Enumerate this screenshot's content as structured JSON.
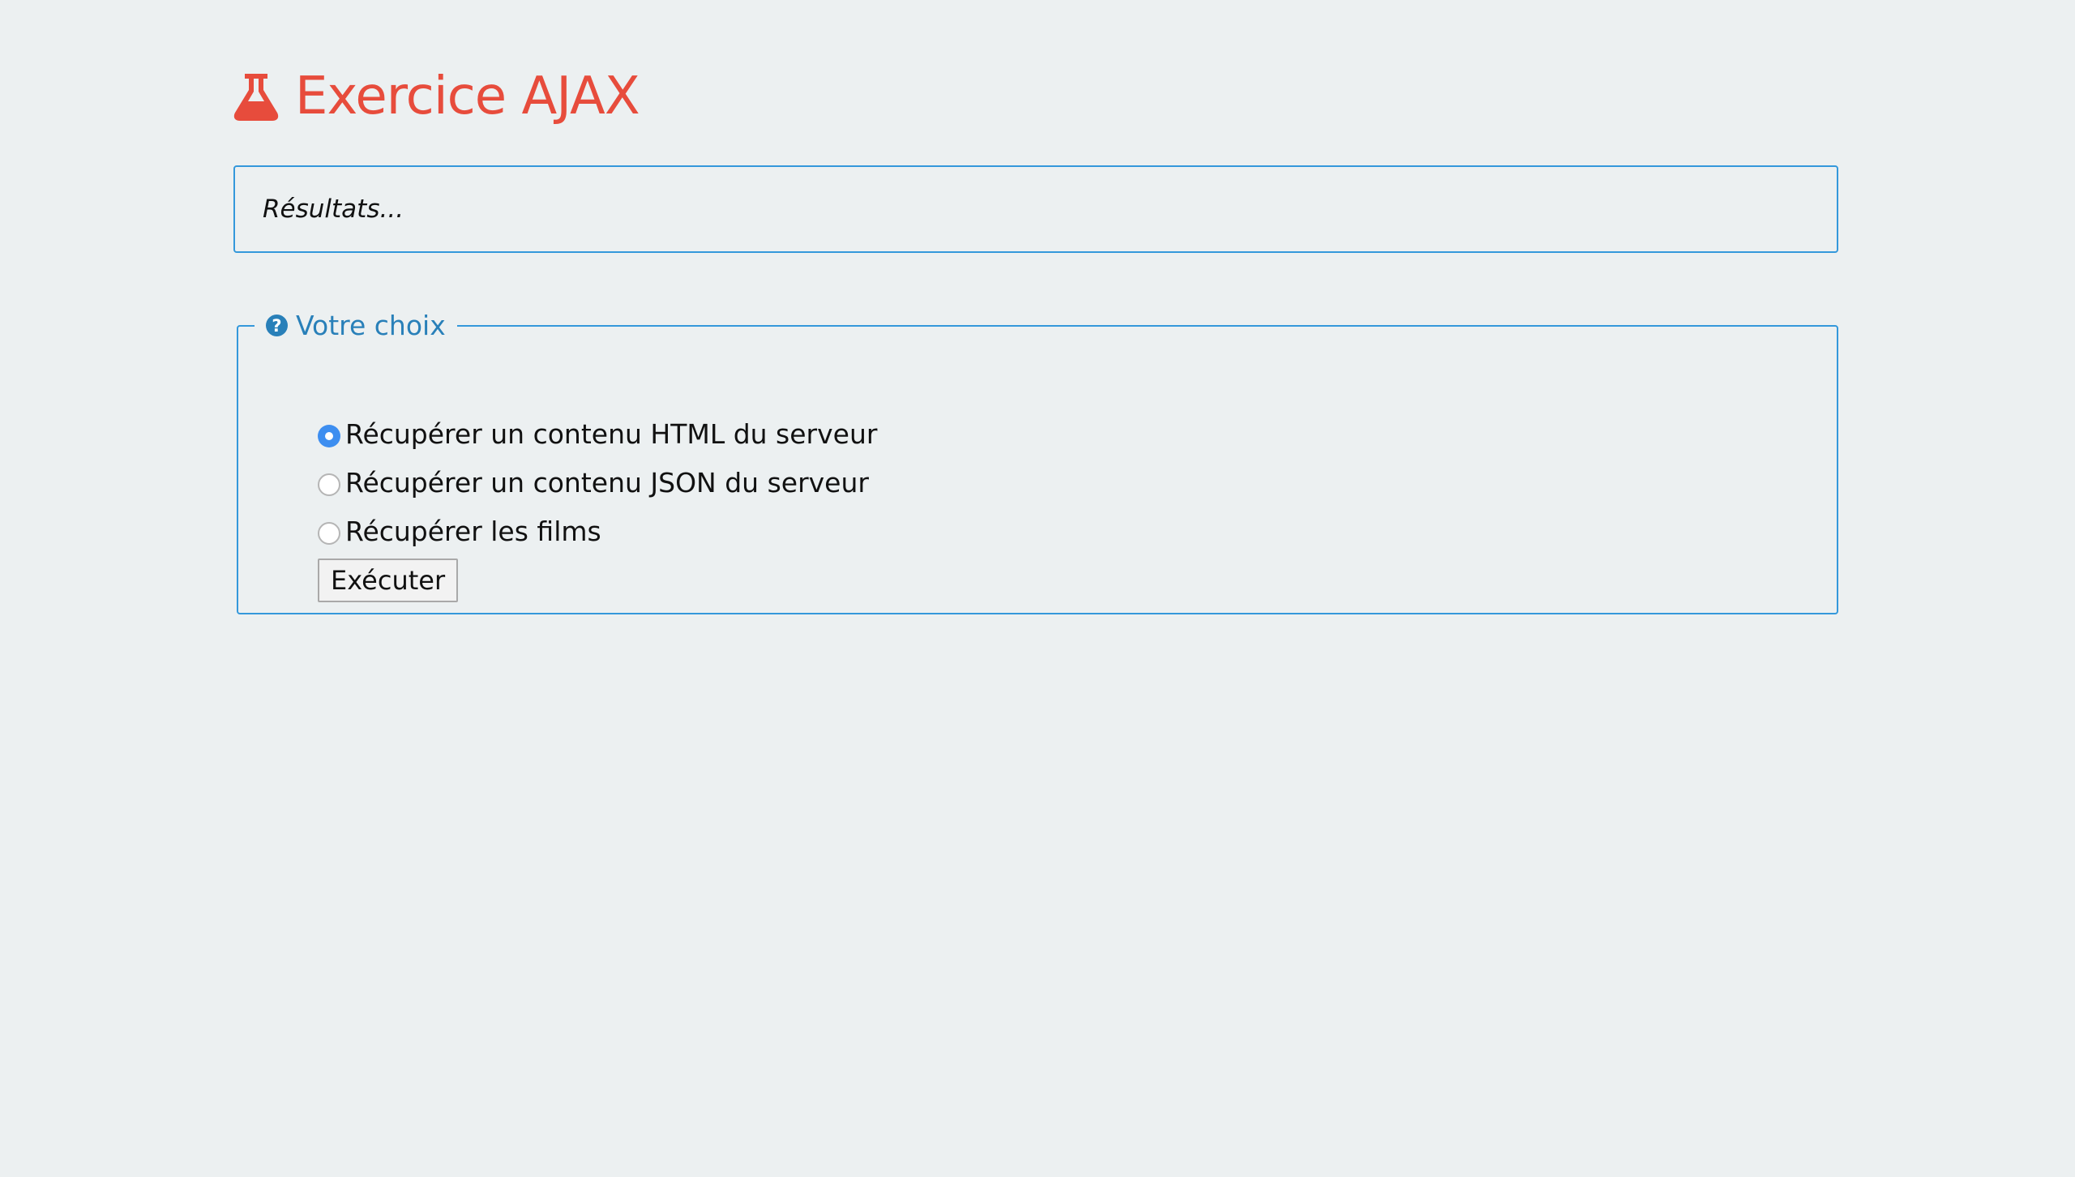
{
  "header": {
    "icon": "flask-icon",
    "title": "Exercice AJAX",
    "accent_color": "#e74c3c"
  },
  "results": {
    "text": "Résultats..."
  },
  "choice": {
    "legend_icon": "question-circle-icon",
    "legend": "Votre choix",
    "border_color": "#3498db",
    "options": [
      {
        "label": "Récupérer un contenu HTML du serveur",
        "checked": true
      },
      {
        "label": "Récupérer un contenu JSON du serveur",
        "checked": false
      },
      {
        "label": "Récupérer les films",
        "checked": false
      }
    ],
    "submit_label": "Exécuter"
  }
}
